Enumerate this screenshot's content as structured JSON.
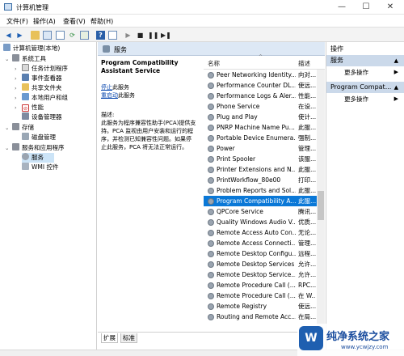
{
  "window": {
    "title": "计算机管理",
    "minimize": "—",
    "maximize": "☐",
    "close": "✕"
  },
  "menu": [
    "文件(F)",
    "操作(A)",
    "查看(V)",
    "帮助(H)"
  ],
  "toolbar_icons": [
    "back-arrow-icon",
    "forward-arrow-icon",
    "folder-icon",
    "view-icon",
    "properties-icon",
    "refresh-icon",
    "export-icon",
    "help-icon",
    "list-view-icon",
    "play-icon",
    "stop-icon",
    "pause-icon",
    "restart-icon"
  ],
  "tree": {
    "root": "计算机管理(本地)",
    "system_tools": "系统工具",
    "task_scheduler": "任务计划程序",
    "event_viewer": "事件查看器",
    "shared_folders": "共享文件夹",
    "local_users": "本地用户和组",
    "performance": "性能",
    "device_manager": "设备管理器",
    "storage": "存储",
    "disk_management": "磁盘管理",
    "services_apps": "服务和应用程序",
    "services": "服务",
    "wmi": "WMI 控件"
  },
  "center": {
    "header": "服务",
    "selected_service": "Program Compatibility Assistant Service",
    "stop_link": "停止",
    "stop_suffix": "此服务",
    "restart_link": "重启动",
    "restart_suffix": "此服务",
    "desc_label": "描述:",
    "desc_lines": [
      "此服务为程序兼容性助手(PCA)提供支",
      "持。PCA 监视由用户安装和运行的程",
      "序，并检测已知兼容性问题。如果停",
      "止此服务，PCA 将无法正常运行。"
    ],
    "col_name": "名称",
    "col_desc": "描述",
    "sort_arrow": "^",
    "tab_extended": "扩展",
    "tab_standard": "标准"
  },
  "services": [
    {
      "name": "Peer Networking Identity...",
      "desc": "向对..."
    },
    {
      "name": "Performance Counter DL...",
      "desc": "使远..."
    },
    {
      "name": "Performance Logs & Aler...",
      "desc": "性能..."
    },
    {
      "name": "Phone Service",
      "desc": "在设..."
    },
    {
      "name": "Plug and Play",
      "desc": "使计..."
    },
    {
      "name": "PNRP Machine Name Pu...",
      "desc": "此服..."
    },
    {
      "name": "Portable Device Enumera...",
      "desc": "强制..."
    },
    {
      "name": "Power",
      "desc": "管理..."
    },
    {
      "name": "Print Spooler",
      "desc": "该服..."
    },
    {
      "name": "Printer Extensions and N...",
      "desc": "此服..."
    },
    {
      "name": "PrintWorkflow_80e00",
      "desc": "打印..."
    },
    {
      "name": "Problem Reports and Sol...",
      "desc": "此服..."
    },
    {
      "name": "Program Compatibility A...",
      "desc": "此服..."
    },
    {
      "name": "QPCore Service",
      "desc": "腾讯..."
    },
    {
      "name": "Quality Windows Audio V...",
      "desc": "优质..."
    },
    {
      "name": "Remote Access Auto Con...",
      "desc": "无论..."
    },
    {
      "name": "Remote Access Connecti...",
      "desc": "管理..."
    },
    {
      "name": "Remote Desktop Configu...",
      "desc": "远程..."
    },
    {
      "name": "Remote Desktop Services",
      "desc": "允许..."
    },
    {
      "name": "Remote Desktop Service...",
      "desc": "允许..."
    },
    {
      "name": "Remote Procedure Call (...",
      "desc": "RPC..."
    },
    {
      "name": "Remote Procedure Call (...",
      "desc": "在 W..."
    },
    {
      "name": "Remote Registry",
      "desc": "使远..."
    },
    {
      "name": "Routing and Remote Acc...",
      "desc": "在局..."
    }
  ],
  "actions": {
    "header": "操作",
    "group1": "服务",
    "more1": "更多操作",
    "group2": "Program Compat...",
    "more2": "更多操作"
  },
  "watermark": {
    "logo": "W",
    "line1": "纯净系统之家",
    "line2": "www.ycwjzy.com"
  }
}
